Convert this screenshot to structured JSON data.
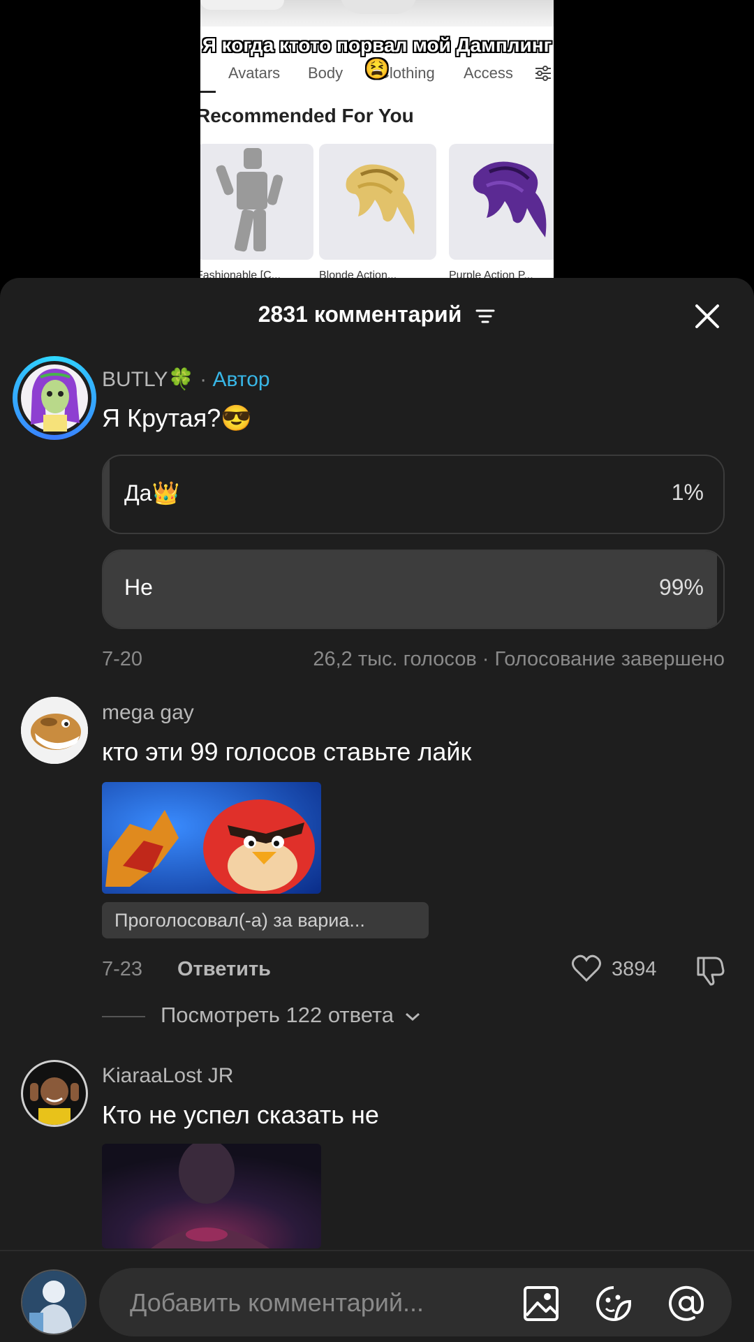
{
  "video": {
    "overlay_caption": "Я когда ктото порвал мой Дамплинг😫",
    "tabs": [
      "Avatars",
      "Body",
      "Clothing",
      "Access"
    ],
    "section_title": "Recommended For You",
    "items": [
      "Fashionable [C...",
      "Blonde Action...",
      "Purple Action P..."
    ]
  },
  "header": {
    "comment_count": "2831 комментарий",
    "icons": [
      "sort-icon",
      "close-icon"
    ]
  },
  "comments": [
    {
      "author": "BUTLY🍀",
      "author_tag": "Автор",
      "text": "Я Крутая?😎",
      "poll": {
        "options": [
          {
            "label": "Да👑",
            "percent_text": "1%",
            "percent": 1
          },
          {
            "label": "Не",
            "percent_text": "99%",
            "percent": 99
          }
        ],
        "date": "7-20",
        "summary": "26,2 тыс. голосов · Голосование завершено"
      }
    },
    {
      "author": "mega gay",
      "text": "кто эти 99 голосов ставьте лайк",
      "vote_chip": "Проголосовал(-а) за вариа...",
      "date": "7-23",
      "reply_label": "Ответить",
      "likes": "3894",
      "view_replies": "Посмотреть 122 ответа"
    },
    {
      "author": "KiaraaLost JR",
      "text": "Кто не успел сказать не"
    }
  ],
  "composer": {
    "placeholder": "Добавить комментарий...",
    "icons": [
      "image-icon",
      "sticker-icon",
      "mention-icon"
    ]
  },
  "colors": {
    "sheet_bg": "#1e1e1e",
    "author_tag": "#38b6e6",
    "poll_fill": "#3d3d3d"
  }
}
